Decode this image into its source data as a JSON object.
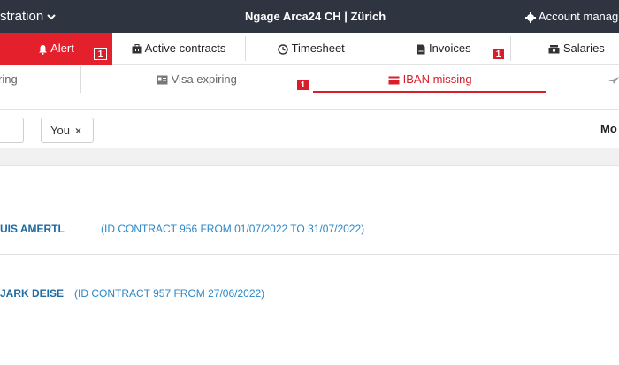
{
  "header": {
    "admin_label": "stration",
    "company": "Ngage Arca24 CH | Zürich",
    "account_label": "Account manag"
  },
  "main_tabs": [
    {
      "label": "Alert",
      "icon": "bell-icon",
      "badge": "1"
    },
    {
      "label": "Active contracts",
      "icon": "briefcase-icon"
    },
    {
      "label": "Timesheet",
      "icon": "clock-icon"
    },
    {
      "label": "Invoices",
      "icon": "invoice-icon",
      "badge": "1"
    },
    {
      "label": "Salaries",
      "icon": "money-icon"
    }
  ],
  "sub_tabs": [
    {
      "label": "ring"
    },
    {
      "label": "Visa expiring",
      "icon": "id-card-icon"
    },
    {
      "label": "IBAN missing",
      "icon": "credit-card-icon",
      "badge": "1"
    }
  ],
  "filters": {
    "chip_label": "You",
    "chip_remove": "×",
    "more_label": "Mo"
  },
  "rows": [
    {
      "name": "UIS AMERTL",
      "contract": "(ID CONTRACT 956 FROM 01/07/2022 TO 31/07/2022)"
    },
    {
      "name": "JARK DEISE",
      "contract": "(ID CONTRACT 957 FROM 27/06/2022)"
    }
  ],
  "colors": {
    "accent": "#e4202c",
    "topbar": "#2e3540",
    "link": "#1e6aa3"
  }
}
